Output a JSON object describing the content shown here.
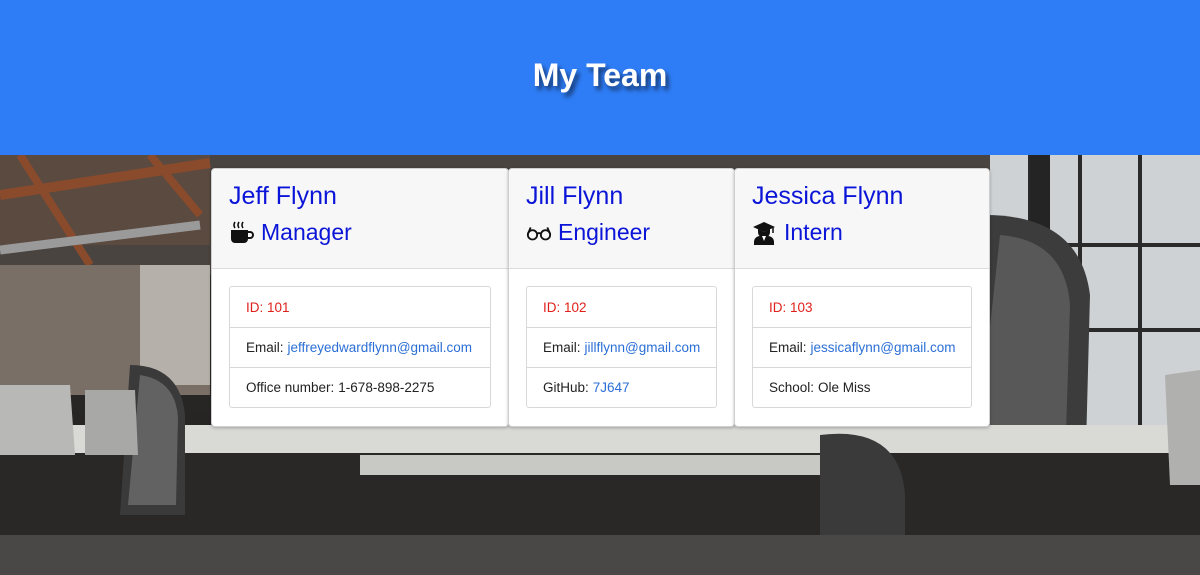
{
  "header": {
    "title": "My Team"
  },
  "team": [
    {
      "name": "Jeff Flynn",
      "role": "Manager",
      "role_icon": "coffee-mug-icon",
      "id_text": "ID: 101",
      "email_label": "Email:",
      "email": "jeffreyedwardflynn@gmail.com",
      "extra_label": "Office number:",
      "extra_value": "1-678-898-2275"
    },
    {
      "name": "Jill Flynn",
      "role": "Engineer",
      "role_icon": "glasses-icon",
      "id_text": "ID: 102",
      "email_label": "Email:",
      "email": "jillflynn@gmail.com",
      "extra_label": "GitHub:",
      "extra_value": "7J647"
    },
    {
      "name": "Jessica Flynn",
      "role": "Intern",
      "role_icon": "graduate-icon",
      "id_text": "ID: 103",
      "email_label": "Email:",
      "email": "jessicaflynn@gmail.com",
      "extra_label": "School:",
      "extra_value": "Ole Miss"
    }
  ],
  "colors": {
    "header_bg": "#2f7df6",
    "name_text": "#0b15d8",
    "id_text": "#e0201b",
    "link": "#2b6fd6"
  }
}
